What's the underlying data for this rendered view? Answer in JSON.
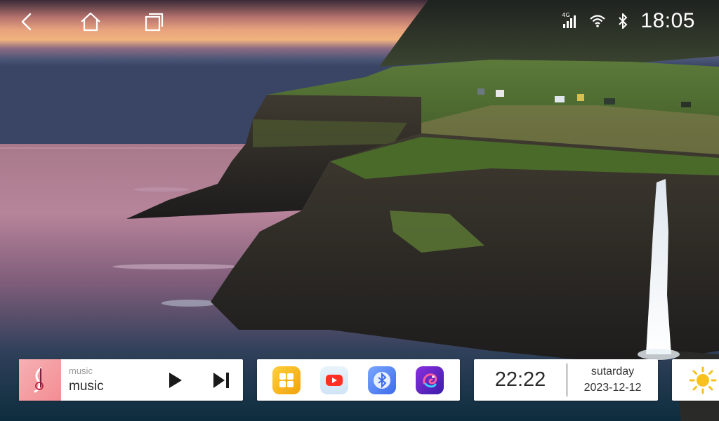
{
  "status_bar": {
    "network": "4G",
    "time": "18:05",
    "icons": [
      "back-icon",
      "home-icon",
      "recents-icon",
      "signal-icon",
      "wifi-icon",
      "bluetooth-icon"
    ]
  },
  "music_widget": {
    "source_label": "music",
    "track_title": "music",
    "icons": [
      "music-note-icon",
      "play-icon",
      "next-track-icon"
    ]
  },
  "app_dock": {
    "apps": [
      {
        "icon": "app-grid-icon",
        "color": "#f5b419"
      },
      {
        "icon": "youtube-icon",
        "color": "#ff3d2e"
      },
      {
        "icon": "bluetooth-icon",
        "color": "#4a7df0"
      },
      {
        "icon": "chameleon-icon",
        "color": "#5a2ad6"
      }
    ]
  },
  "clock_widget": {
    "time": "22:22",
    "day": "sutarday",
    "date": "2023-12-12"
  },
  "weather_widget": {
    "icon": "sun-icon",
    "color": "#f7c21c"
  }
}
